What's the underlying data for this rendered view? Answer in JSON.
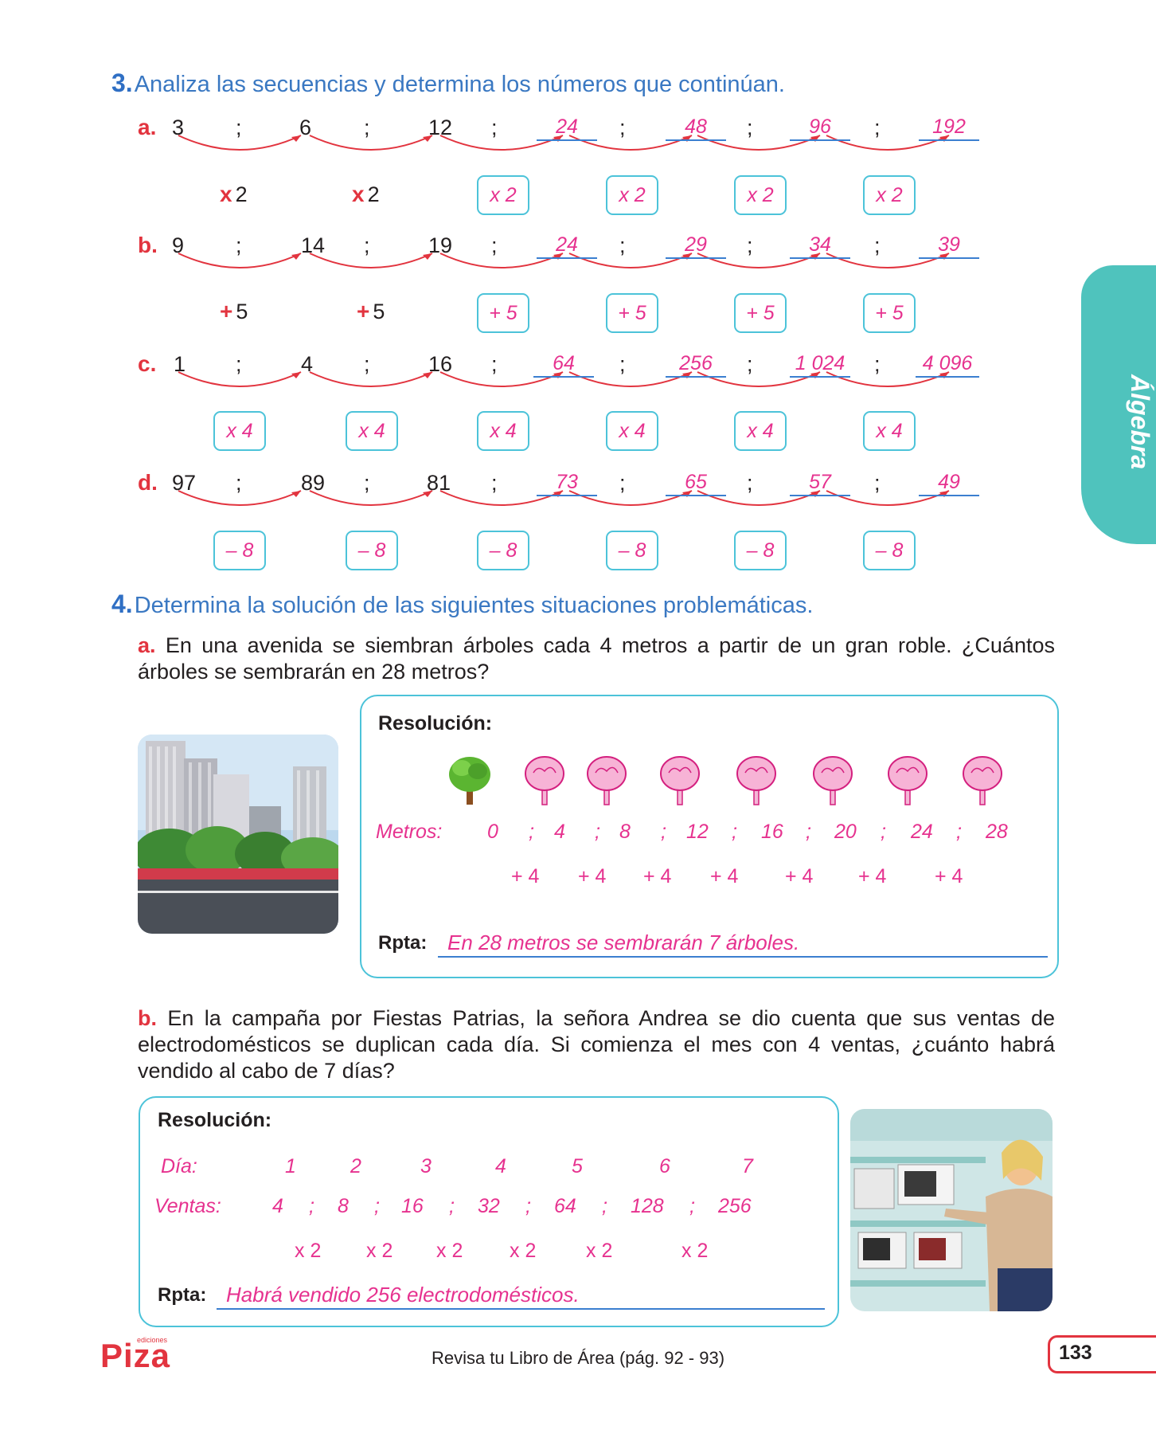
{
  "exercise3": {
    "number": "3.",
    "instruction": "Analiza las secuencias y determina los números que continúan.",
    "rows": [
      {
        "letter": "a.",
        "given": [
          "3",
          "6",
          "12"
        ],
        "answers": [
          "24",
          "48",
          "96",
          "192"
        ],
        "ops": [
          "2",
          "2",
          "x 2",
          "x 2",
          "x 2",
          "x 2"
        ],
        "opsign": "x"
      },
      {
        "letter": "b.",
        "given": [
          "9",
          "14",
          "19"
        ],
        "answers": [
          "24",
          "29",
          "34",
          "39"
        ],
        "ops": [
          "5",
          "5",
          "+ 5",
          "+ 5",
          "+ 5",
          "+ 5"
        ],
        "opsign": "+"
      },
      {
        "letter": "c.",
        "given": [
          "1",
          "4",
          "16"
        ],
        "answers": [
          "64",
          "256",
          "1 024",
          "4 096"
        ],
        "ops": [
          "x 4",
          "x 4",
          "x 4",
          "x 4",
          "x 4",
          "x 4"
        ]
      },
      {
        "letter": "d.",
        "given": [
          "97",
          "89",
          "81"
        ],
        "answers": [
          "73",
          "65",
          "57",
          "49"
        ],
        "ops": [
          "– 8",
          "– 8",
          "– 8",
          "– 8",
          "– 8",
          "– 8"
        ]
      }
    ],
    "separator": ";"
  },
  "exercise4": {
    "number": "4.",
    "instruction": "Determina la solución de las siguientes situaciones problemáticas.",
    "a": {
      "letter": "a.",
      "text": "En una avenida se siembran árboles cada 4 metros a partir de un gran roble. ¿Cuántos árboles se sembrarán en 28 metros?",
      "resolucion_label": "Resolución:",
      "metros_label": "Metros:",
      "metros": [
        "0",
        "4",
        "8",
        "12",
        "16",
        "20",
        "24",
        "28"
      ],
      "step": "+ 4",
      "rpta_label": "Rpta:",
      "rpta": "En 28 metros se sembrarán 7 árboles."
    },
    "b": {
      "letter": "b.",
      "text": "En la campaña por Fiestas Patrias, la señora Andrea se dio cuenta que sus ventas de electrodomésticos se duplican cada día. Si comienza el mes con 4 ventas, ¿cuánto habrá vendido al cabo de 7 días?",
      "resolucion_label": "Resolución:",
      "dia_label": "Día:",
      "dias": [
        "1",
        "2",
        "3",
        "4",
        "5",
        "6",
        "7"
      ],
      "ventas_label": "Ventas:",
      "ventas": [
        "4",
        "8",
        "16",
        "32",
        "64",
        "128",
        "256"
      ],
      "step": "x 2",
      "rpta_label": "Rpta:",
      "rpta": "Habrá vendido 256 electrodomésticos."
    }
  },
  "side_tab": "Álgebra",
  "footer": {
    "text": "Revisa tu Libro de Área (pág. 92 - 93)",
    "page": "133",
    "logo": "Piza",
    "logo_small": "ediciones"
  },
  "colors": {
    "accent_blue": "#3a78c2",
    "red": "#e2343f",
    "magenta": "#e6328f",
    "teal": "#4fc3bd",
    "box_border": "#4cc3d9"
  }
}
